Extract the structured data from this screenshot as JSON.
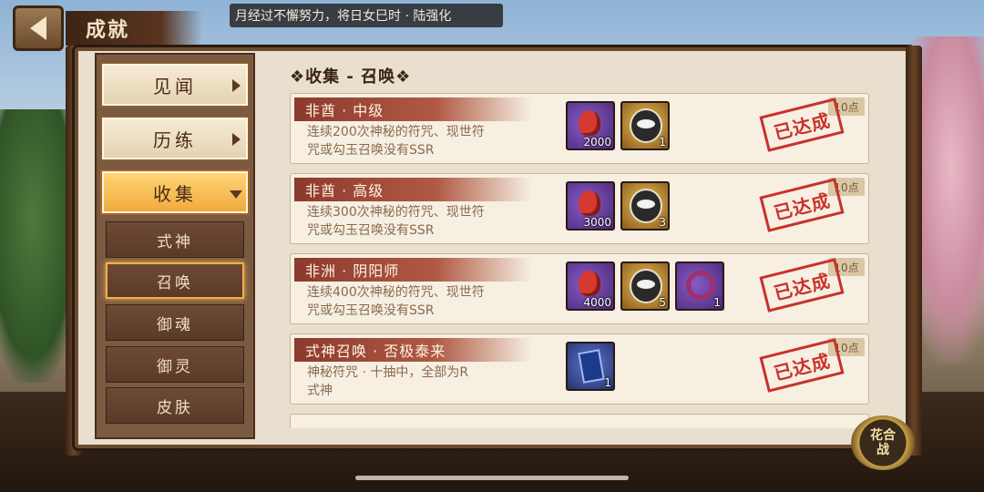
{
  "header": {
    "title": "成就",
    "marquee": "月经过不懈努力，将日女巳时 · 陆强化"
  },
  "nav": {
    "main": [
      {
        "label": "见闻",
        "active": false
      },
      {
        "label": "历练",
        "active": false
      },
      {
        "label": "收集",
        "active": true
      }
    ],
    "sub": [
      {
        "label": "式神",
        "selected": false
      },
      {
        "label": "召唤",
        "selected": true
      },
      {
        "label": "御魂",
        "selected": false
      },
      {
        "label": "御灵",
        "selected": false
      },
      {
        "label": "皮肤",
        "selected": false
      }
    ]
  },
  "content": {
    "section_title": "❖收集 - 召唤❖",
    "achievements": [
      {
        "name": "非酋 · 中级",
        "desc_line1": "连续200次神秘的符咒、现世符",
        "desc_line2": "咒或勾玉召唤没有SSR",
        "points": "10点",
        "status": "已达成",
        "rewards": [
          {
            "icon": "mystery-talisman",
            "count": "2000"
          },
          {
            "icon": "daruma",
            "count": "1"
          }
        ]
      },
      {
        "name": "非酋 · 高级",
        "desc_line1": "连续300次神秘的符咒、现世符",
        "desc_line2": "咒或勾玉召唤没有SSR",
        "points": "10点",
        "status": "已达成",
        "rewards": [
          {
            "icon": "mystery-talisman",
            "count": "3000"
          },
          {
            "icon": "daruma",
            "count": "3"
          }
        ]
      },
      {
        "name": "非洲 · 阴阳师",
        "desc_line1": "连续400次神秘的符咒、现世符",
        "desc_line2": "咒或勾玉召唤没有SSR",
        "points": "10点",
        "status": "已达成",
        "rewards": [
          {
            "icon": "mystery-talisman",
            "count": "4000"
          },
          {
            "icon": "daruma",
            "count": "5"
          },
          {
            "icon": "frame-ring",
            "count": "1"
          }
        ]
      },
      {
        "name": "式神召唤 · 否极泰来",
        "desc_line1": "神秘符咒 · 十抽中，全部为R",
        "desc_line2": "式神",
        "points": "10点",
        "status": "已达成",
        "rewards": [
          {
            "icon": "summon-scroll",
            "count": "1"
          }
        ]
      }
    ]
  },
  "battle_button": {
    "label": "花合战"
  }
}
